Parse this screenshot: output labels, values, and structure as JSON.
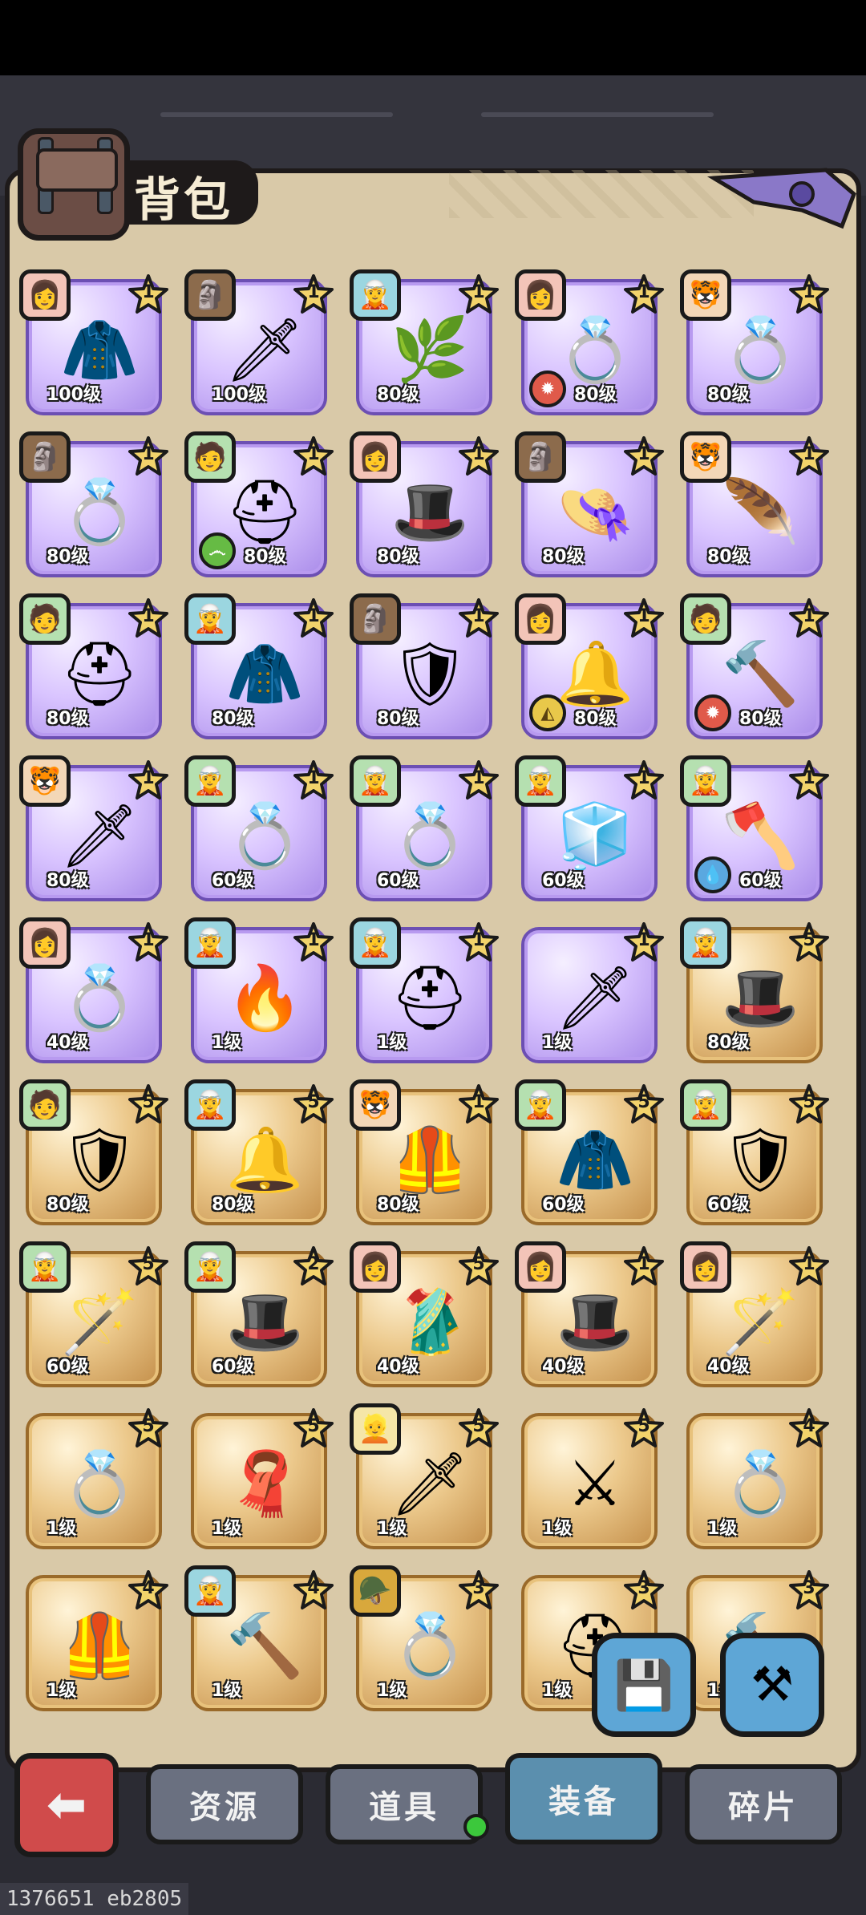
{
  "title": "背包",
  "tabs": [
    {
      "label": "资源",
      "active": false
    },
    {
      "label": "道具",
      "active": false,
      "has_dot": true
    },
    {
      "label": "装备",
      "active": true
    },
    {
      "label": "碎片",
      "active": false
    }
  ],
  "floating_buttons": [
    {
      "name": "save-icon",
      "glyph": "💾"
    },
    {
      "name": "anvil-icon",
      "glyph": "⚒"
    }
  ],
  "back_glyph": "⬅",
  "version": "1376651 eb2805",
  "items": [
    {
      "rarity": "purple",
      "level": "100级",
      "stars": "1",
      "avatar": "red",
      "avatar_glyph": "👩",
      "item_icon": "cloak-icon",
      "item_glyph": "🧥"
    },
    {
      "rarity": "purple",
      "level": "100级",
      "stars": "1",
      "avatar": "brown",
      "avatar_glyph": "🗿",
      "item_icon": "dagger-icon",
      "item_glyph": "🗡"
    },
    {
      "rarity": "purple",
      "level": "80级",
      "stars": "1",
      "avatar": "cyan",
      "avatar_glyph": "🧝",
      "item_icon": "wreath-icon",
      "item_glyph": "🌿"
    },
    {
      "rarity": "purple",
      "level": "80级",
      "stars": "1",
      "avatar": "red",
      "avatar_glyph": "👩",
      "item_icon": "ring-icon",
      "item_glyph": "💍",
      "element": "fire"
    },
    {
      "rarity": "purple",
      "level": "80级",
      "stars": "1",
      "avatar": "tiger",
      "avatar_glyph": "🐯",
      "item_icon": "ring-icon",
      "item_glyph": "💍"
    },
    {
      "rarity": "purple",
      "level": "80级",
      "stars": "1",
      "avatar": "brown",
      "avatar_glyph": "🗿",
      "item_icon": "ring-icon",
      "item_glyph": "💍"
    },
    {
      "rarity": "purple",
      "level": "80级",
      "stars": "1",
      "avatar": "green",
      "avatar_glyph": "🧑",
      "item_icon": "helmet-icon",
      "item_glyph": "⛑",
      "element": "wind"
    },
    {
      "rarity": "purple",
      "level": "80级",
      "stars": "1",
      "avatar": "red",
      "avatar_glyph": "👩",
      "item_icon": "witch-hat-icon",
      "item_glyph": "🎩"
    },
    {
      "rarity": "purple",
      "level": "80级",
      "stars": "1",
      "avatar": "brown",
      "avatar_glyph": "🗿",
      "item_icon": "hat-icon",
      "item_glyph": "👒"
    },
    {
      "rarity": "purple",
      "level": "80级",
      "stars": "1",
      "avatar": "tiger",
      "avatar_glyph": "🐯",
      "item_icon": "feather-hat-icon",
      "item_glyph": "🪶"
    },
    {
      "rarity": "purple",
      "level": "80级",
      "stars": "1",
      "avatar": "green",
      "avatar_glyph": "🧑",
      "item_icon": "helmet-icon",
      "item_glyph": "⛑"
    },
    {
      "rarity": "purple",
      "level": "80级",
      "stars": "1",
      "avatar": "cyan",
      "avatar_glyph": "🧝",
      "item_icon": "cloak-icon",
      "item_glyph": "🧥"
    },
    {
      "rarity": "purple",
      "level": "80级",
      "stars": "1",
      "avatar": "brown",
      "avatar_glyph": "🗿",
      "item_icon": "armor-icon",
      "item_glyph": "🛡"
    },
    {
      "rarity": "purple",
      "level": "80级",
      "stars": "1",
      "avatar": "red",
      "avatar_glyph": "👩",
      "item_icon": "bell-icon",
      "item_glyph": "🔔",
      "element": "earth"
    },
    {
      "rarity": "purple",
      "level": "80级",
      "stars": "1",
      "avatar": "green",
      "avatar_glyph": "🧑",
      "item_icon": "hammer-icon",
      "item_glyph": "🔨",
      "element": "fire"
    },
    {
      "rarity": "purple",
      "level": "80级",
      "stars": "1",
      "avatar": "tiger",
      "avatar_glyph": "🐯",
      "item_icon": "sword-icon",
      "item_glyph": "🗡"
    },
    {
      "rarity": "purple",
      "level": "60级",
      "stars": "1",
      "avatar": "green",
      "avatar_glyph": "🧝",
      "item_icon": "ring-icon",
      "item_glyph": "💍"
    },
    {
      "rarity": "purple",
      "level": "60级",
      "stars": "1",
      "avatar": "green",
      "avatar_glyph": "🧝",
      "item_icon": "ring-icon",
      "item_glyph": "💍"
    },
    {
      "rarity": "purple",
      "level": "60级",
      "stars": "1",
      "avatar": "green",
      "avatar_glyph": "🧝",
      "item_icon": "ice-helmet-icon",
      "item_glyph": "🧊"
    },
    {
      "rarity": "purple",
      "level": "60级",
      "stars": "1",
      "avatar": "green",
      "avatar_glyph": "🧝",
      "item_icon": "axe-icon",
      "item_glyph": "🪓",
      "element": "water"
    },
    {
      "rarity": "purple",
      "level": "40级",
      "stars": "1",
      "avatar": "red",
      "avatar_glyph": "👩",
      "item_icon": "ring-icon",
      "item_glyph": "💍"
    },
    {
      "rarity": "purple",
      "level": "1级",
      "stars": "1",
      "avatar": "cyan",
      "avatar_glyph": "🧝",
      "item_icon": "fire-ring-icon",
      "item_glyph": "🔥"
    },
    {
      "rarity": "purple",
      "level": "1级",
      "stars": "1",
      "avatar": "cyan",
      "avatar_glyph": "🧝",
      "item_icon": "helmet-icon",
      "item_glyph": "⛑"
    },
    {
      "rarity": "purple",
      "level": "1级",
      "stars": "1",
      "item_icon": "sword-icon",
      "item_glyph": "🗡"
    },
    {
      "rarity": "gold",
      "level": "80级",
      "stars": "5",
      "avatar": "cyan",
      "avatar_glyph": "🧝",
      "item_icon": "witch-hat-icon",
      "item_glyph": "🎩"
    },
    {
      "rarity": "gold",
      "level": "80级",
      "stars": "5",
      "avatar": "green",
      "avatar_glyph": "🧑",
      "item_icon": "armor-icon",
      "item_glyph": "🛡"
    },
    {
      "rarity": "gold",
      "level": "80级",
      "stars": "5",
      "avatar": "cyan",
      "avatar_glyph": "🧝",
      "item_icon": "bell-icon",
      "item_glyph": "🔔"
    },
    {
      "rarity": "gold",
      "level": "80级",
      "stars": "1",
      "avatar": "tiger",
      "avatar_glyph": "🐯",
      "item_icon": "armor-icon",
      "item_glyph": "🦺"
    },
    {
      "rarity": "gold",
      "level": "60级",
      "stars": "5",
      "avatar": "green",
      "avatar_glyph": "🧝",
      "item_icon": "cloak-icon",
      "item_glyph": "🧥"
    },
    {
      "rarity": "gold",
      "level": "60级",
      "stars": "5",
      "avatar": "green",
      "avatar_glyph": "🧝",
      "item_icon": "armor-icon",
      "item_glyph": "🛡"
    },
    {
      "rarity": "gold",
      "level": "60级",
      "stars": "5",
      "avatar": "green",
      "avatar_glyph": "🧝",
      "item_icon": "staff-icon",
      "item_glyph": "🪄"
    },
    {
      "rarity": "gold",
      "level": "60级",
      "stars": "2",
      "avatar": "green",
      "avatar_glyph": "🧝",
      "item_icon": "witch-hat-icon",
      "item_glyph": "🎩"
    },
    {
      "rarity": "gold",
      "level": "40级",
      "stars": "5",
      "avatar": "red",
      "avatar_glyph": "👩",
      "item_icon": "robe-icon",
      "item_glyph": "🥻"
    },
    {
      "rarity": "gold",
      "level": "40级",
      "stars": "1",
      "avatar": "red",
      "avatar_glyph": "👩",
      "item_icon": "witch-hat-icon",
      "item_glyph": "🎩"
    },
    {
      "rarity": "gold",
      "level": "40级",
      "stars": "1",
      "avatar": "red",
      "avatar_glyph": "👩",
      "item_icon": "staff-icon",
      "item_glyph": "🪄"
    },
    {
      "rarity": "gold",
      "level": "1级",
      "stars": "5",
      "item_icon": "ring-icon",
      "item_glyph": "💍"
    },
    {
      "rarity": "gold",
      "level": "1级",
      "stars": "5",
      "item_icon": "hood-icon",
      "item_glyph": "🧣"
    },
    {
      "rarity": "gold",
      "level": "1级",
      "stars": "5",
      "avatar": "blonde",
      "avatar_glyph": "👱",
      "item_icon": "dagger-icon",
      "item_glyph": "🗡"
    },
    {
      "rarity": "gold",
      "level": "1级",
      "stars": "5",
      "item_icon": "sword-icon",
      "item_glyph": "⚔"
    },
    {
      "rarity": "gold",
      "level": "1级",
      "stars": "4",
      "item_icon": "ring-icon",
      "item_glyph": "💍"
    },
    {
      "rarity": "gold",
      "level": "1级",
      "stars": "4",
      "item_icon": "armor-icon",
      "item_glyph": "🦺"
    },
    {
      "rarity": "gold",
      "level": "1级",
      "stars": "4",
      "avatar": "cyan",
      "avatar_glyph": "🧝",
      "item_icon": "hammer-icon",
      "item_glyph": "🔨"
    },
    {
      "rarity": "gold",
      "level": "1级",
      "stars": "3",
      "avatar": "helm",
      "avatar_glyph": "🪖",
      "item_icon": "ring-icon",
      "item_glyph": "💍"
    },
    {
      "rarity": "gold",
      "level": "1级",
      "stars": "3",
      "item_icon": "helmet-icon",
      "item_glyph": "⛑"
    },
    {
      "rarity": "gold",
      "level": "1级",
      "stars": "3",
      "item_icon": "hammer-icon",
      "item_glyph": "🔨"
    }
  ]
}
